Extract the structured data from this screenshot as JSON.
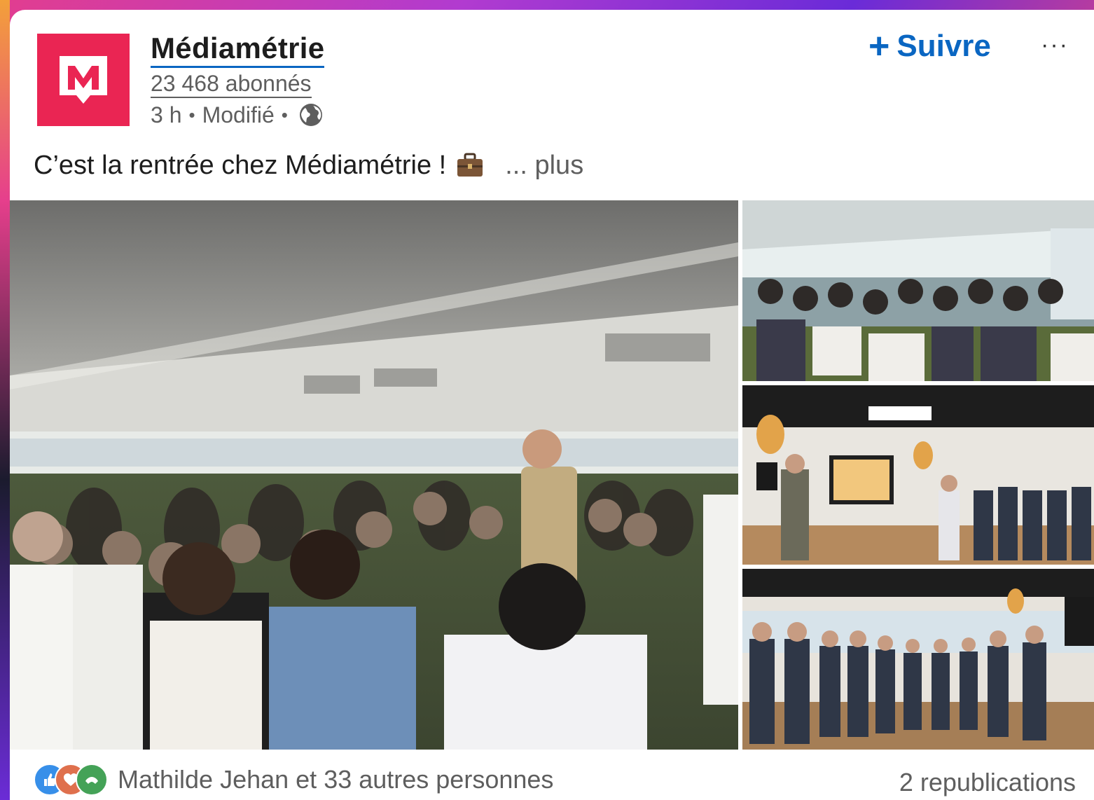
{
  "post": {
    "author": {
      "name": "Médiamétrie",
      "followers": "23 468 abonnés",
      "time": "3 h",
      "edited": "Modifié",
      "visibility_icon": "globe-icon",
      "logo_letter": "M",
      "logo_color": "#ea2553"
    },
    "follow_label": "Suivre",
    "more_options_label": "···",
    "text": "C’est la rentrée chez Médiamétrie !",
    "text_emoji": "briefcase-icon",
    "see_more_label": "... plus",
    "images": [
      {
        "id": "main",
        "alt": "Audience in open-space office listening to a speaker"
      },
      {
        "id": "top-right",
        "alt": "Seated audience in bright office"
      },
      {
        "id": "middle-right",
        "alt": "Presenter with screen and standing audience"
      },
      {
        "id": "bottom-right",
        "alt": "Standing group in room with wooden floor"
      }
    ],
    "reactions": {
      "icons": [
        "like-icon",
        "love-icon",
        "support-icon"
      ],
      "text": "Mathilde Jehan et 33 autres personnes"
    },
    "reposts": "2 republications"
  },
  "colors": {
    "link_blue": "#0a66c2",
    "text_primary": "#1d1d1d",
    "text_secondary": "#5e5e5e"
  }
}
